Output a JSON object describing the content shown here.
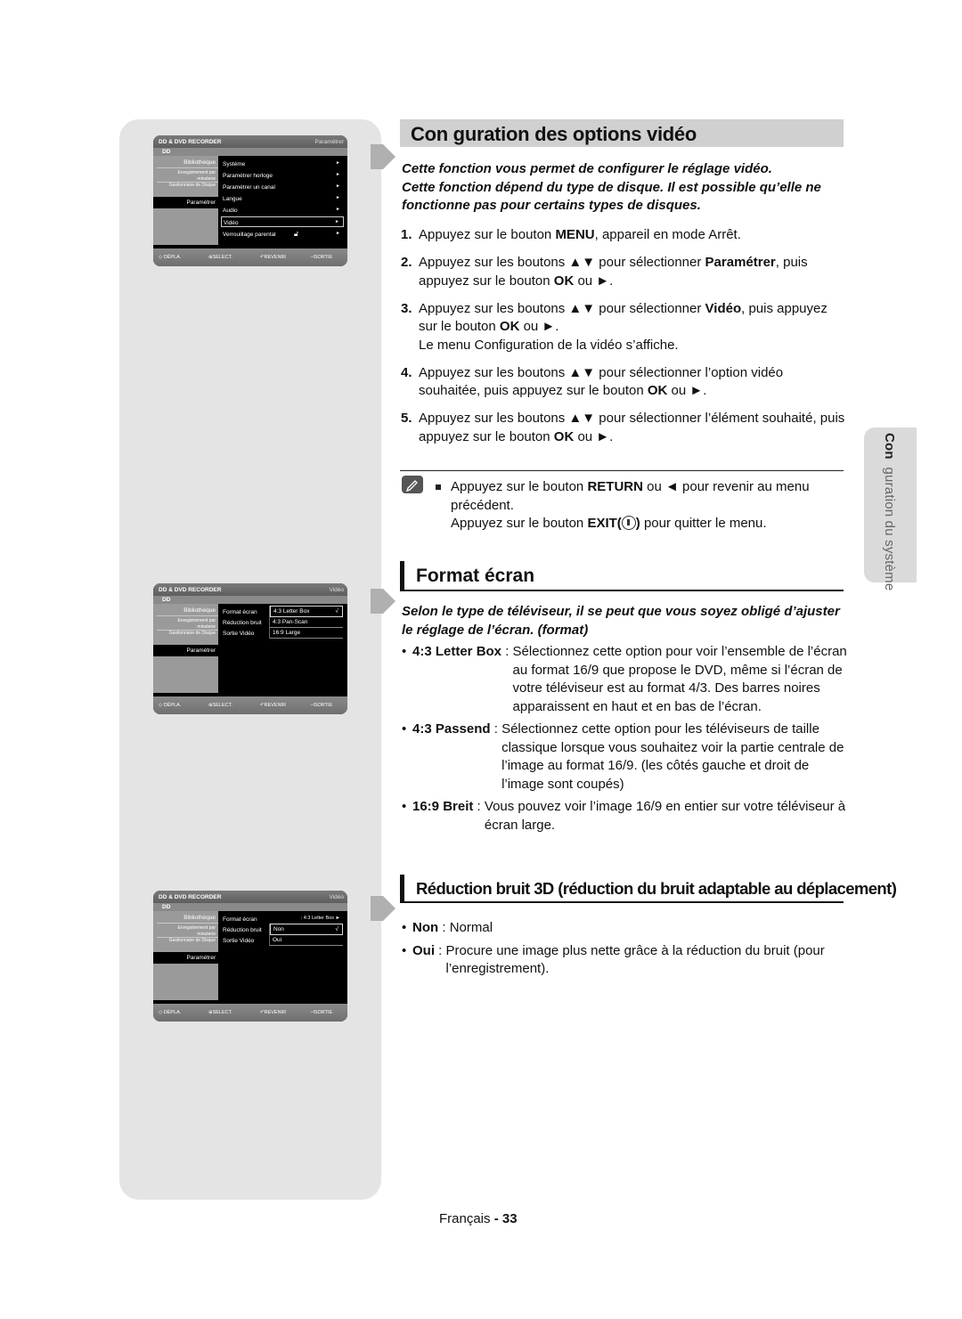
{
  "section_title": "Con  guration des options vidéo",
  "intro": {
    "line1": "Cette fonction vous permet de configurer le réglage vidéo.",
    "line2": "Cette fonction dépend du type de disque. Il est possible qu’elle ne fonctionne pas pour certains types de disques."
  },
  "steps": [
    {
      "num": "1.",
      "pre": "Appuyez sur le bouton ",
      "b1": "MENU",
      "mid": ", appareil en mode Arrêt.",
      "b2": "",
      "post": "",
      "extra": ""
    },
    {
      "num": "2.",
      "pre": "Appuyez sur les boutons ▲▼ pour sélectionner ",
      "b1": "Paramétrer",
      "mid": ", puis appuyez sur le bouton ",
      "b2": "OK",
      "post": " ou ►.",
      "extra": ""
    },
    {
      "num": "3.",
      "pre": "Appuyez sur les boutons ▲▼ pour sélectionner ",
      "b1": "Vidéo",
      "mid": ", puis appuyez sur le bouton ",
      "b2": "OK",
      "post": " ou ►.",
      "extra": "Le menu Configuration de la vidéo s’affiche."
    },
    {
      "num": "4.",
      "pre": "Appuyez sur les boutons ▲▼ pour sélectionner l’option vidéo souhaitée, puis appuyez sur le bouton ",
      "b1": "OK",
      "mid": " ou ►.",
      "b2": "",
      "post": "",
      "extra": ""
    },
    {
      "num": "5.",
      "pre": "Appuyez sur les boutons ▲▼ pour sélectionner l’élément souhaité, puis appuyez sur le bouton ",
      "b1": "OK",
      "mid": " ou ►.",
      "b2": "",
      "post": "",
      "extra": ""
    }
  ],
  "note": {
    "icon": "pencil-note-icon",
    "l1_pre": "Appuyez sur le bouton ",
    "l1_b": "RETURN",
    "l1_post": " ou ◄ pour revenir au menu précédent.",
    "l2_pre": "Appuyez sur le bouton ",
    "l2_b": "EXIT(",
    "l2_b2": ")",
    "l2_post": "  pour quitter le menu."
  },
  "format": {
    "title": "Format écran",
    "intro": "Selon le type de téléviseur, il se peut que vous soyez obligé d’ajuster le réglage de l’écran. (format)",
    "items": [
      {
        "term": "4:3 Letter Box",
        "sep": " : ",
        "desc": "Sélectionnez cette option pour voir l’ensemble de l’écran au format 16/9 que propose le DVD, même si l’écran de votre téléviseur est au format 4/3. Des barres noires apparaissent en haut et en bas de l’écran."
      },
      {
        "term": "4:3 Passend",
        "sep": " : ",
        "desc": "Sélectionnez cette option pour les téléviseurs de taille classique lorsque vous souhaitez voir la partie centrale de l’image au format 16/9. (les côtés gauche et droit de l’image sont coupés)"
      },
      {
        "term": "16:9 Breit",
        "sep": " : ",
        "desc": "Vous pouvez voir l’image 16/9 en entier sur votre téléviseur à écran large."
      }
    ]
  },
  "noise": {
    "title": "Réduction bruit 3D (réduction du bruit adaptable au déplacement)",
    "items": [
      {
        "term": "Non",
        "sep": " : ",
        "desc": "Normal"
      },
      {
        "term": "Oui",
        "sep": " : ",
        "desc": "Procure une image plus nette grâce à la réduction du bruit (pour l’enregistrement)."
      }
    ]
  },
  "side_tab": {
    "first": "Con",
    "rest": "  guration du système"
  },
  "page": {
    "lang": "Français",
    "sep": " - ",
    "num": "33"
  },
  "osd_common": {
    "title": "DD & DVD RECORDER",
    "sub": "DD",
    "left": [
      "Bibliothèque",
      "Enregistrement par minuterie",
      "Gestionnaire de Disque",
      "Paramétrer"
    ],
    "footer": [
      "◇ DÉPLA.",
      "⊕SELECT.",
      "↶REVENIR",
      "⊣SORTIE"
    ]
  },
  "osd1": {
    "crumb": "Paramétrer",
    "items": [
      {
        "label": "Système",
        "arrow": "►"
      },
      {
        "label": "Paramétrer horloge",
        "arrow": "►"
      },
      {
        "label": "Paramétrer un canal",
        "arrow": "►"
      },
      {
        "label": "Langue",
        "arrow": "►"
      },
      {
        "label": "Audio",
        "arrow": "►"
      },
      {
        "label": "Vidéo",
        "arrow": "►"
      },
      {
        "label": "Verrouillage parental",
        "arrow": "►"
      }
    ],
    "selected": "Vidéo"
  },
  "osd2": {
    "crumb": "Vidéo",
    "items": [
      "Format écran",
      "Réduction bruit",
      "Sortie Vidéo"
    ],
    "popup": [
      "4:3 Letter Box",
      "4:3 Pan-Scan",
      "16:9 Large"
    ],
    "check": "√"
  },
  "osd3": {
    "crumb": "Vidéo",
    "items": [
      "Format écran",
      "Réduction bruit",
      "Sortie Vidéo"
    ],
    "format_value": ": 4:3 Letter Box ►",
    "popup": [
      "Non",
      "Oui"
    ],
    "check": "√"
  }
}
